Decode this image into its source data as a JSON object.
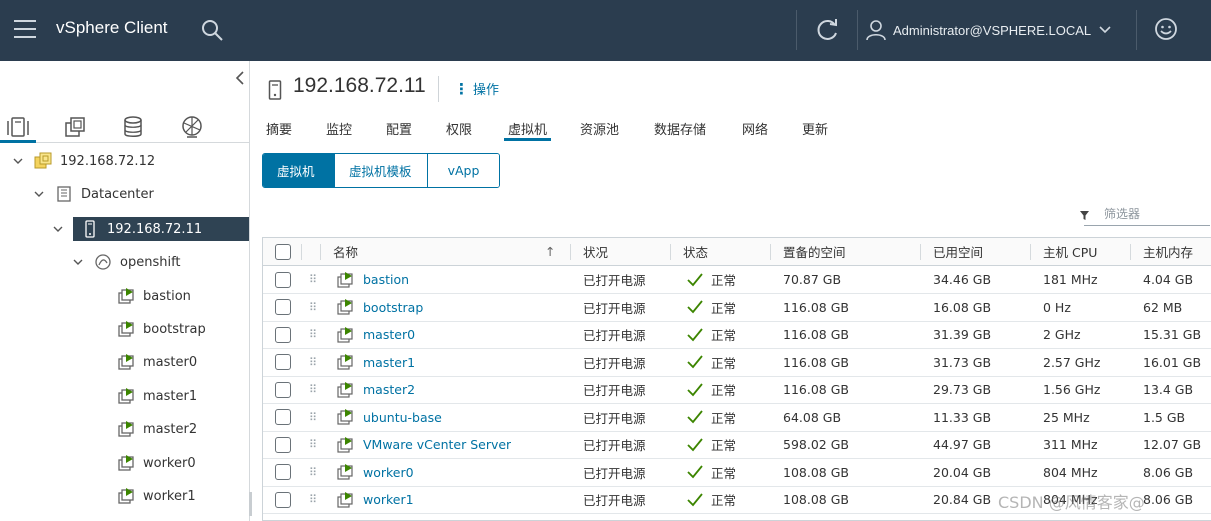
{
  "app": {
    "title": "vSphere Client",
    "user": "Administrator@VSPHERE.LOCAL"
  },
  "icons": {
    "menu": "hamburger-icon",
    "search": "search-icon",
    "refresh": "refresh-icon",
    "user": "user-icon",
    "feedback": "smiley-icon",
    "host": "host-server-icon",
    "vm": "vm-powered-on-icon",
    "status_ok": "check-icon",
    "filter": "filter-icon"
  },
  "colors": {
    "topbar": "#2b3d4f",
    "accent": "#0072a3",
    "selected_tree": "#2f4353",
    "ok": "#3c8500"
  },
  "nav_tabs": [
    "hosts-and-clusters-icon",
    "vms-and-templates-icon",
    "storage-icon",
    "networking-icon"
  ],
  "tree": {
    "vcenter": "192.168.72.12",
    "datacenter": "Datacenter",
    "host": "192.168.72.11",
    "pool": "openshift",
    "vms": [
      "bastion",
      "bootstrap",
      "master0",
      "master1",
      "master2",
      "worker0",
      "worker1"
    ]
  },
  "main": {
    "host_title": "192.168.72.11",
    "actions_label": "操作",
    "tabs": [
      "摘要",
      "监控",
      "配置",
      "权限",
      "虚拟机",
      "资源池",
      "数据存储",
      "网络",
      "更新"
    ],
    "active_tab": "虚拟机",
    "segments": [
      "虚拟机",
      "虚拟机模板",
      "vApp"
    ],
    "filter_placeholder": "筛选器"
  },
  "table": {
    "columns": [
      "名称",
      "状况",
      "状态",
      "置备的空间",
      "已用空间",
      "主机 CPU",
      "主机内存"
    ],
    "sort_indicator": "↑",
    "rows": [
      {
        "name": "bastion",
        "condition": "已打开电源",
        "status": "正常",
        "provisioned": "70.87 GB",
        "used": "34.46 GB",
        "cpu": "181 MHz",
        "mem": "4.04 GB"
      },
      {
        "name": "bootstrap",
        "condition": "已打开电源",
        "status": "正常",
        "provisioned": "116.08 GB",
        "used": "16.08 GB",
        "cpu": "0 Hz",
        "mem": "62 MB"
      },
      {
        "name": "master0",
        "condition": "已打开电源",
        "status": "正常",
        "provisioned": "116.08 GB",
        "used": "31.39 GB",
        "cpu": "2 GHz",
        "mem": "15.31 GB"
      },
      {
        "name": "master1",
        "condition": "已打开电源",
        "status": "正常",
        "provisioned": "116.08 GB",
        "used": "31.73 GB",
        "cpu": "2.57 GHz",
        "mem": "16.01 GB"
      },
      {
        "name": "master2",
        "condition": "已打开电源",
        "status": "正常",
        "provisioned": "116.08 GB",
        "used": "29.73 GB",
        "cpu": "1.56 GHz",
        "mem": "13.4 GB"
      },
      {
        "name": "ubuntu-base",
        "condition": "已打开电源",
        "status": "正常",
        "provisioned": "64.08 GB",
        "used": "11.33 GB",
        "cpu": "25 MHz",
        "mem": "1.5 GB"
      },
      {
        "name": "VMware vCenter Server",
        "condition": "已打开电源",
        "status": "正常",
        "provisioned": "598.02 GB",
        "used": "44.97 GB",
        "cpu": "311 MHz",
        "mem": "12.07 GB"
      },
      {
        "name": "worker0",
        "condition": "已打开电源",
        "status": "正常",
        "provisioned": "108.08 GB",
        "used": "20.04 GB",
        "cpu": "804 MHz",
        "mem": "8.06 GB"
      },
      {
        "name": "worker1",
        "condition": "已打开电源",
        "status": "正常",
        "provisioned": "108.08 GB",
        "used": "20.84 GB",
        "cpu": "804 MHz",
        "mem": "8.06 GB"
      }
    ]
  },
  "watermark": "CSDN @风情客家@"
}
